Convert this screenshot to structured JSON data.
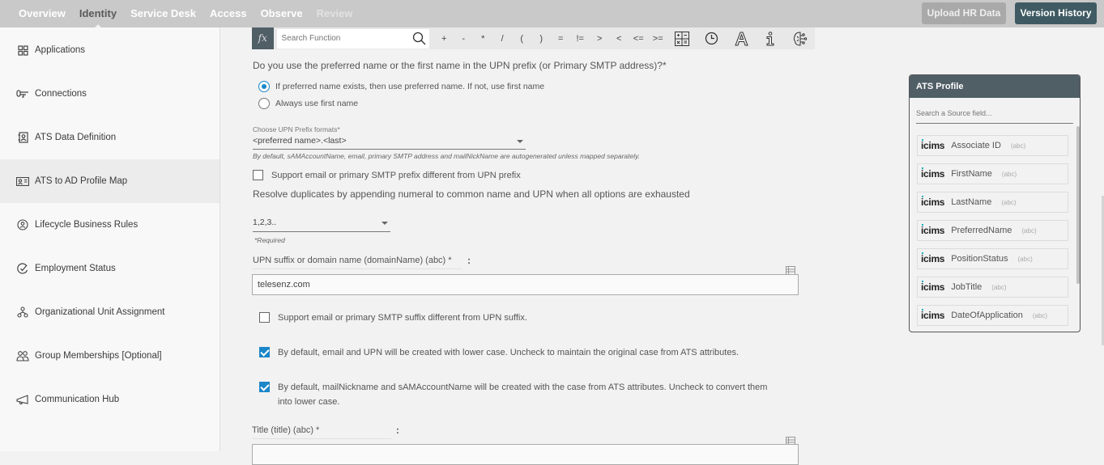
{
  "topnav": {
    "items": [
      {
        "label": "Overview",
        "state": "normal"
      },
      {
        "label": "Identity",
        "state": "active"
      },
      {
        "label": "Service Desk",
        "state": "normal"
      },
      {
        "label": "Access",
        "state": "normal"
      },
      {
        "label": "Observe",
        "state": "normal"
      },
      {
        "label": "Review",
        "state": "disabled"
      }
    ],
    "upload_label": "Upload HR Data",
    "version_label": "Version History"
  },
  "sidebar": {
    "items": [
      {
        "label": "Applications",
        "icon": "grid-icon"
      },
      {
        "label": "Connections",
        "icon": "connector-icon"
      },
      {
        "label": "ATS Data Definition",
        "icon": "contact-book-icon"
      },
      {
        "label": "ATS to AD Profile Map",
        "icon": "id-card-icon",
        "active": true
      },
      {
        "label": "Lifecycle Business Rules",
        "icon": "user-circle-icon"
      },
      {
        "label": "Employment Status",
        "icon": "check-circle-icon"
      },
      {
        "label": "Organizational Unit Assignment",
        "icon": "org-chart-icon"
      },
      {
        "label": "Group Memberships [Optional]",
        "icon": "group-icon"
      },
      {
        "label": "Communication Hub",
        "icon": "megaphone-icon"
      }
    ]
  },
  "function_bar": {
    "fx_label": "fx",
    "search_placeholder": "Search Function",
    "operators": [
      "+",
      "-",
      "*",
      "/",
      "(",
      ")",
      "=",
      "!=",
      ">",
      "<",
      "<=",
      ">="
    ],
    "tools": [
      "calculator-icon",
      "clock-icon",
      "text-format-icon",
      "info-icon",
      "ai-brain-icon"
    ]
  },
  "form": {
    "name_question": "Do you use the preferred name or the first name in the UPN prefix (or Primary SMTP address)?*",
    "name_options": [
      {
        "label": "If preferred name exists, then use preferred name. If not, use first name",
        "selected": true
      },
      {
        "label": "Always use first name",
        "selected": false
      }
    ],
    "upn_prefix_caption": "Choose UPN Prefix formats*",
    "upn_prefix_value": "<preferred name>.<last>",
    "upn_prefix_hint": "By default, sAMAccountName, email, primary SMTP address and mailNickName are autogenerated unless mapped separately.",
    "support_prefix_label": "Support email or primary SMTP prefix different from UPN prefix",
    "support_prefix_checked": false,
    "resolve_label": "Resolve duplicates by appending numeral to common name and UPN when all options are exhausted",
    "resolve_value": "1,2,3..",
    "required_note": "*Required",
    "upn_suffix_label": "UPN suffix or domain name (domainName) (abc) *",
    "upn_suffix_value": "telesenz.com",
    "colon": ":",
    "support_suffix_label": "Support email or primary SMTP suffix different from UPN suffix.",
    "support_suffix_checked": false,
    "lowercase_label": "By default, email and UPN will be created with lower case. Uncheck to maintain the original case from ATS attributes.",
    "lowercase_checked": true,
    "case_label": "By default, mailNickname and sAMAccountName will be created with the case from ATS attributes. Uncheck to convert them into lower case.",
    "case_checked": true,
    "title_label": "Title (title) (abc) *",
    "title_value": ""
  },
  "ats_profile": {
    "title": "ATS Profile",
    "search_placeholder": "Search a Source field...",
    "source_logo": "icims",
    "fields": [
      {
        "name": "Associate ID",
        "type": "(abc)"
      },
      {
        "name": "FirstName",
        "type": "(abc)"
      },
      {
        "name": "LastName",
        "type": "(abc)"
      },
      {
        "name": "PreferredName",
        "type": "(abc)"
      },
      {
        "name": "PositionStatus",
        "type": "(abc)"
      },
      {
        "name": "JobTitle",
        "type": "(abc)"
      },
      {
        "name": "DateOfApplication",
        "type": "(abc)"
      }
    ]
  }
}
